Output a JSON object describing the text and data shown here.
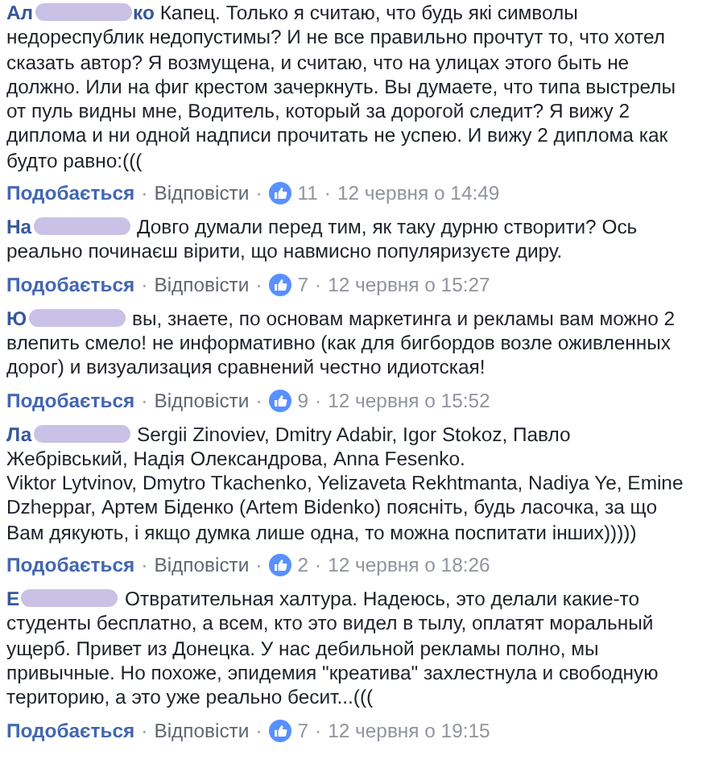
{
  "separator": "·",
  "comments": [
    {
      "author_start": "Ал",
      "author_end": "ко",
      "text": "Капец. Только я считаю, что будь які символы недореспублик недопустимы? И не все правильно прочтут то, что хотел сказать автор? Я возмущена, и считаю, что на улицах этого быть не должно. Или на фиг крестом зачеркнуть. Вы думаете, что типа выстрелы от пуль видны мне, Водитель, который за дорогой следит? Я вижу 2 диплома и ни одной надписи прочитать не успею. И вижу 2 диплома как будто равно:(((",
      "like": "Подобається",
      "reply": "Відповісти",
      "likes": "11",
      "date": "12 червня о 14:49"
    },
    {
      "author_start": "На",
      "text": "Довго думали перед тим, як таку дурню створити? Ось реально починаєш вірити, що навмисно популяризуєте диру.",
      "like": "Подобається",
      "reply": "Відповісти",
      "likes": "7",
      "date": "12 червня о 15:27"
    },
    {
      "author_start": "Ю",
      "text": "вы, знаете, по основам маркетинга и рекламы вам можно 2 влепить смело! не информативно (как для бигбордов возле оживленных дорог) и визуализация сравнений честно идиотская!",
      "like": "Подобається",
      "reply": "Відповісти",
      "likes": "9",
      "date": "12 червня о 15:52"
    },
    {
      "author_start": "Ла",
      "text": "Sergii Zinoviev, Dmitry Adabir, Igor Stokoz, Павло Жебрівський, Надія Олександрова, Anna Fesenko.\nViktor Lytvinov, Dmytro Tkachenko, Yelizaveta Rekhtmanta, Nadiya Ye, Emine Dzheppar, Артем Біденко (Artem Bidenko) поясніть, будь ласочка, за що Вам дякують, і якщо думка лише одна, то можна поспитати інших)))))",
      "like": "Подобається",
      "reply": "Відповісти",
      "likes": "2",
      "date": "12 червня о 18:26"
    },
    {
      "author_start": "Е",
      "text": "Отвратительная халтура. Надеюсь, это делали какие-то студенты бесплатно, а всем, кто это видел в тылу, оплатят моральный ущерб. Привет из Донецка. У нас дебильной рекламы полно, мы привычные. Но похоже, эпидемия \"креатива\" захлестнула и свободную територию, а это уже реально бесит...(((",
      "like": "Подобається",
      "reply": "Відповісти",
      "likes": "7",
      "date": "12 червня о 19:15"
    }
  ]
}
